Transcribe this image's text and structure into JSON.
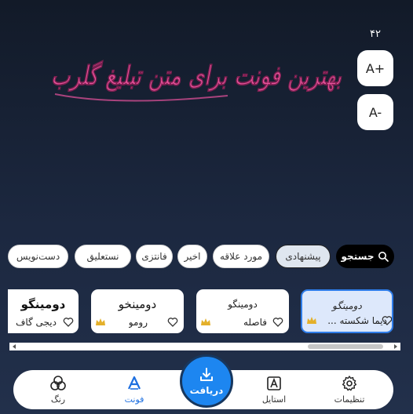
{
  "font_size": {
    "value": "۴۲",
    "increase_label": "A+",
    "decrease_label": "A-"
  },
  "preview_text": "بهترین فونت برای متن تبلیغ گلرب",
  "preview_color": "#e8539c",
  "filters": {
    "search": "جستجو",
    "chips": [
      "پیشنهادی",
      "مورد علاقه",
      "اخیر",
      "فانتزی",
      "نستعلیق",
      "دست‌نویس"
    ],
    "selected": "پیشنهادی"
  },
  "fonts": [
    {
      "sample": "دومینگو",
      "name": "دیما شکسته ...",
      "premium": true,
      "selected": true
    },
    {
      "sample": "دومینگو",
      "name": "فاصله",
      "premium": true,
      "selected": false
    },
    {
      "sample": "دومینخو",
      "name": "رومو",
      "premium": true,
      "selected": false
    },
    {
      "sample": "دومینگو",
      "name": "دیجی گاف",
      "premium": false,
      "selected": false
    }
  ],
  "nav": {
    "settings": "تنظیمات",
    "style": "استایل",
    "download": "دریافت",
    "font": "فونت",
    "color": "رنگ"
  },
  "colors": {
    "accent": "#1d86f0",
    "active_nav": "#1d6fe0",
    "selected_card": "#dde8fb",
    "crown": "#e4b02a",
    "background": "#1c2840"
  }
}
